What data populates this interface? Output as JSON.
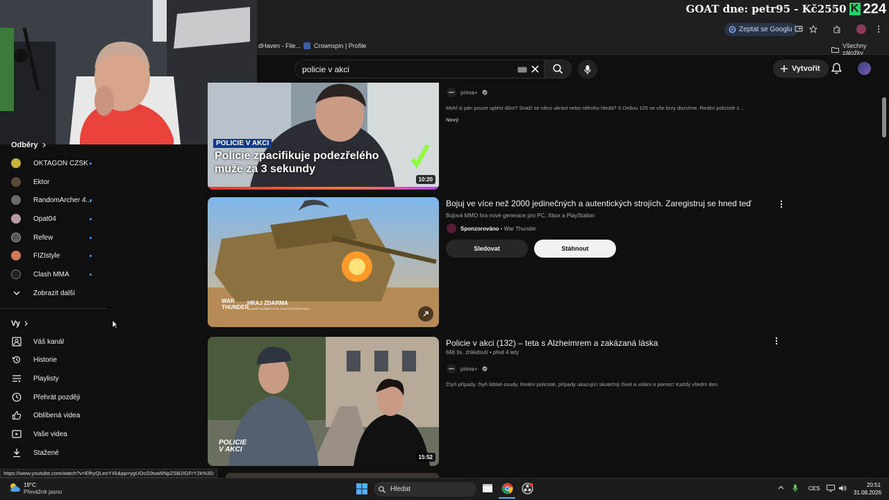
{
  "overlay": {
    "goat_text": "GOAT dne: petr95 - Kč2550",
    "k_logo": "K",
    "counter": "224"
  },
  "browser": {
    "ask_google": "Zeptat se Googlu",
    "bookmarks": [
      {
        "label": "dHaven - File..."
      },
      {
        "label": "Crownspin | Profile"
      }
    ],
    "all_bookmarks": "Všechny záložky"
  },
  "youtube": {
    "search_query": "policie v akci",
    "create_label": "Vytvořit"
  },
  "sidebar": {
    "subscriptions_title": "Odběry",
    "subscriptions": [
      {
        "label": "OKTAGON CZSK",
        "color": "#c9b23a"
      },
      {
        "label": "Ektor",
        "color": "#5a4a3a"
      },
      {
        "label": "RandomArcher 4...",
        "color": "#6a6a6a"
      },
      {
        "label": "Opat04",
        "color": "#b89aa8"
      },
      {
        "label": "Refew",
        "color": "#555555"
      },
      {
        "label": "FIZIstyle",
        "color": "#d07a5a"
      },
      {
        "label": "Clash MMA",
        "color": "#222222"
      }
    ],
    "show_more": "Zobrazit další",
    "you_title": "Vy",
    "you_items": [
      {
        "label": "Váš kanál",
        "icon": "account-box-icon"
      },
      {
        "label": "Historie",
        "icon": "history-icon"
      },
      {
        "label": "Playlisty",
        "icon": "playlist-icon"
      },
      {
        "label": "Přehrát později",
        "icon": "clock-icon"
      },
      {
        "label": "Oblíbená videa",
        "icon": "thumb-up-icon"
      },
      {
        "label": "Vaše videa",
        "icon": "video-icon"
      },
      {
        "label": "Stažené",
        "icon": "download-icon"
      }
    ]
  },
  "videos": {
    "v1": {
      "thumb_tag": "POLICIE V AKCI",
      "thumb_title_1": "Policie zpacifikuje podezřelého",
      "thumb_title_2": "muže za 3 sekundy",
      "duration": "10:20",
      "channel": "prima+",
      "description": "Mohl si pán pouze splést dům? Snaží se něco ukrást nebo někoho hledá? S Deltou 105 se vše brzy dozvíme. Reální policisté s ...",
      "badge": "Nový"
    },
    "ad": {
      "title": "Bojuj ve více než 2000 jedinečných a autentických strojích. Zaregistruj se hned teď",
      "subtitle": "Bojová MMO hra nové generace pro PC, Xbox a PlayStation",
      "sponsored": "Sponzorováno",
      "advertiser": "• War Thunder",
      "thumb_logo": "WAR THUNDER",
      "thumb_caption": "HRAJ ZDARMA",
      "thumb_small": "NA WARTHUNDER.COM, PLAYSTATION A XBOX",
      "subscribe": "Sledovat",
      "download": "Stáhnout"
    },
    "v2": {
      "title": "Policie v akci (132) – teta s Alzheimrem a zakázaná láska",
      "meta": "666 tis. zhlédnutí • před 4 lety",
      "channel": "prima+",
      "description": "Čtyři případy, čtyři lidské osudy. Reální policisté, případy ukazující skutečný život a volání o pomoc! Každý všední den.",
      "thumb_logo_1": "POLICIE",
      "thumb_logo_2": "V AKCI",
      "duration": "15:52"
    }
  },
  "status_url": "https://www.youtube.com/watch?v=EfhyQLeoYXk&pp=ygUOcG9saWNpZSB2IGFrY2k%3D",
  "taskbar": {
    "temperature": "19°C",
    "weather": "Převážně jasno",
    "search": "Hledat",
    "language": "CES",
    "time": "20:51",
    "date": "31.08.2026"
  }
}
